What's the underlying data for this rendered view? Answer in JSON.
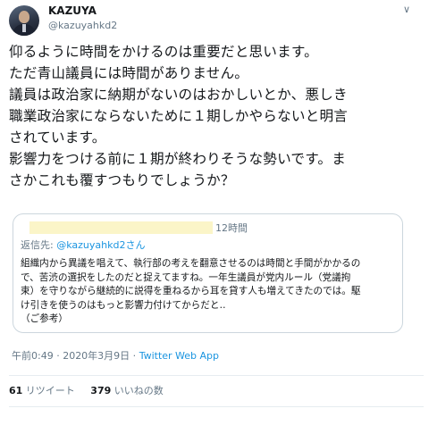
{
  "author": {
    "name": "KAZUYA",
    "handle": "@kazuyahkd2"
  },
  "menu_caret": "∨",
  "tweet": {
    "text": "仰るように時間をかけるのは重要だと思います。\nただ青山議員には時間がありません。\n議員は政治家に納期がないのはおかしいとか、悪しき\n職業政治家にならないために１期しかやらないと明言\nされています。\n影響力をつける前に１期が終わりそうな勢いです。ま\nさかこれも覆すつもりでしょうか？"
  },
  "quote": {
    "time": "12時間",
    "reply_prefix": "返信先: ",
    "reply_mention": "@kazuyahkd2さん",
    "text": "組織内から異議を唱えて、執行部の考えを翻意させるのは時間と手間がかかるの\nで、苦渋の選択をしたのだと捉えてますね。一年生議員が党内ルール（党議拘\n束）を守りながら継続的に説得を重ねるから耳を貸す人も増えてきたのでは。駆\nけ引きを使うのはもっと影響力付けてからだと‥\n（ご参考）"
  },
  "meta": {
    "timestamp": "午前0:49 · 2020年3月9日 · ",
    "app": "Twitter Web App"
  },
  "stats": {
    "retweets": "61",
    "retweets_label": " リツイート",
    "likes": "379",
    "likes_label": " いいねの数"
  }
}
